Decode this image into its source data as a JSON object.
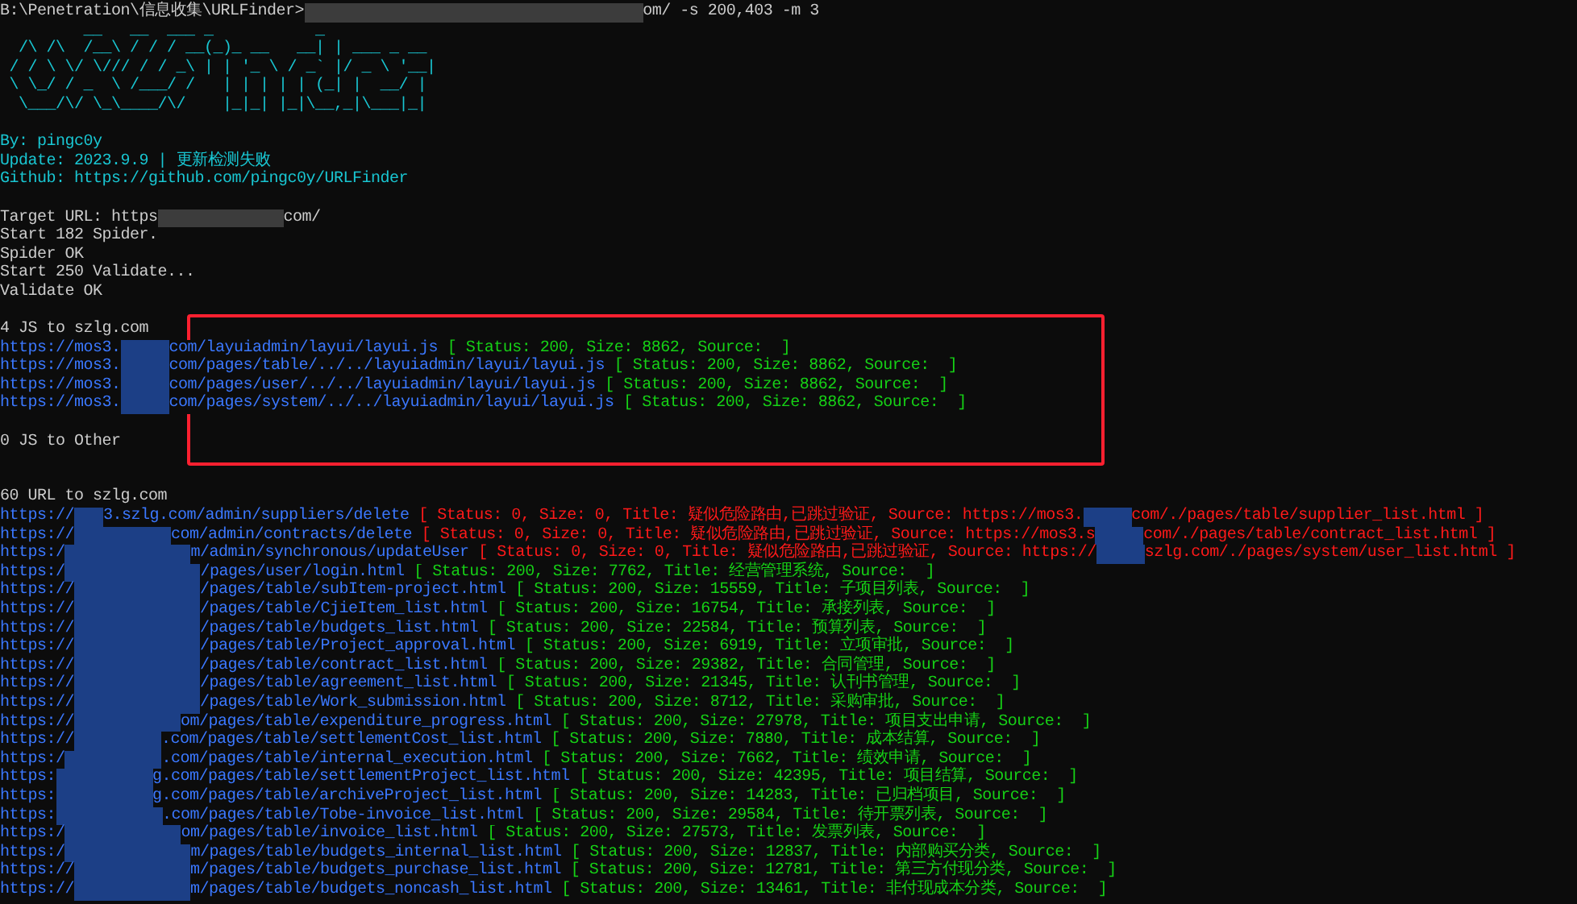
{
  "command": {
    "prompt": "B:\\Penetration\\信息收集\\URLFinder>",
    "tail": "om/ -s 200,403 -m 3"
  },
  "banner": "         __   __  ___ _           _\n  /\\ /\\  /__\\ / / / __(_)_ __   __| | ___ _ __\n / / \\ \\/ \\/// / / _\\ | | '_ \\ / _` |/ _ \\ '__|\n \\ \\_/ / _  \\ /___/ /   | | | | | (_| |  __/ |\n  \\___/\\/ \\_\\____/\\/    |_|_| |_|\\__,_|\\___|_|",
  "info": [
    "By: pingc0y",
    "Update: 2023.9.9 | 更新检测失败",
    "Github: https://github.com/pingc0y/URLFinder"
  ],
  "target": {
    "label": "Target URL: https",
    "tail": "com/"
  },
  "progress": [
    "Start 182 Spider.",
    "Spider OK",
    "Start 250 Validate...",
    "Validate OK"
  ],
  "js_to_target": {
    "heading": "4 JS to szlg.com",
    "results": [
      {
        "kind": "ok",
        "url": [
          "https://mos3.",
          "com/layuiadmin/layui/layui.js"
        ],
        "detail": [
          "[ Status: 200, Size: 8862, Source:  ]"
        ]
      },
      {
        "kind": "ok",
        "url": [
          "https://mos3.",
          "com/pages/table/../../layuiadmin/layui/layui.js"
        ],
        "detail": [
          "[ Status: 200, Size: 8862, Source:  ]"
        ]
      },
      {
        "kind": "ok",
        "url": [
          "https://mos3.",
          "com/pages/user/../../layuiadmin/layui/layui.js"
        ],
        "detail": [
          "[ Status: 200, Size: 8862, Source:  ]"
        ]
      },
      {
        "kind": "ok",
        "url": [
          "https://mos3.",
          "com/pages/system/../../layuiadmin/layui/layui.js"
        ],
        "detail": [
          "[ Status: 200, Size: 8862, Source:  ]"
        ]
      }
    ]
  },
  "js_to_other": {
    "heading": "0 JS to Other"
  },
  "urls": {
    "heading": "60 URL to szlg.com",
    "results": [
      {
        "kind": "danger",
        "url": [
          "https://",
          "3.szlg.com/admin/suppliers/delete"
        ],
        "detail": [
          "[ Status: 0, Size: 0, Title: 疑似危险路由,已跳过验证, Source: https://mos3.",
          "com/./pages/table/supplier_list.html ]"
        ]
      },
      {
        "kind": "danger",
        "url": [
          "https://",
          "com/admin/contracts/delete"
        ],
        "detail": [
          "[ Status: 0, Size: 0, Title: 疑似危险路由,已跳过验证, Source: https://mos3.s",
          "com/./pages/table/contract_list.html ]"
        ]
      },
      {
        "kind": "danger",
        "url": [
          "https:/",
          "m/admin/synchronous/updateUser"
        ],
        "detail": [
          "[ Status: 0, Size: 0, Title: 疑似危险路由,已跳过验证, Source: https://",
          "szlg.com/./pages/system/user_list.html ]"
        ]
      },
      {
        "kind": "ok",
        "url": [
          "https:/",
          "/pages/user/login.html"
        ],
        "detail": [
          "[ Status: 200, Size: 7762, Title: 经营管理系统, Source:  ]"
        ]
      },
      {
        "kind": "ok",
        "url": [
          "https://",
          "/pages/table/subItem-project.html"
        ],
        "detail": [
          "[ Status: 200, Size: 15559, Title: 子项目列表, Source:  ]"
        ]
      },
      {
        "kind": "ok",
        "url": [
          "https://",
          "/pages/table/CjieItem_list.html"
        ],
        "detail": [
          "[ Status: 200, Size: 16754, Title: 承接列表, Source:  ]"
        ]
      },
      {
        "kind": "ok",
        "url": [
          "https://",
          "/pages/table/budgets_list.html"
        ],
        "detail": [
          "[ Status: 200, Size: 22584, Title: 预算列表, Source:  ]"
        ]
      },
      {
        "kind": "ok",
        "url": [
          "https://",
          "/pages/table/Project_approval.html"
        ],
        "detail": [
          "[ Status: 200, Size: 6919, Title: 立项审批, Source:  ]"
        ]
      },
      {
        "kind": "ok",
        "url": [
          "https://",
          "/pages/table/contract_list.html"
        ],
        "detail": [
          "[ Status: 200, Size: 29382, Title: 合同管理, Source:  ]"
        ]
      },
      {
        "kind": "ok",
        "url": [
          "https://",
          "/pages/table/agreement_list.html"
        ],
        "detail": [
          "[ Status: 200, Size: 21345, Title: 认刊书管理, Source:  ]"
        ]
      },
      {
        "kind": "ok",
        "url": [
          "https://",
          "/pages/table/Work_submission.html"
        ],
        "detail": [
          "[ Status: 200, Size: 8712, Title: 采购审批, Source:  ]"
        ]
      },
      {
        "kind": "ok",
        "url": [
          "https://",
          "om/pages/table/expenditure_progress.html"
        ],
        "detail": [
          "[ Status: 200, Size: 27978, Title: 项目支出申请, Source:  ]"
        ]
      },
      {
        "kind": "ok",
        "url": [
          "https://",
          ".com/pages/table/settlementCost_list.html"
        ],
        "detail": [
          "[ Status: 200, Size: 7880, Title: 成本结算, Source:  ]"
        ]
      },
      {
        "kind": "ok",
        "url": [
          "https:/",
          ".com/pages/table/internal_execution.html"
        ],
        "detail": [
          "[ Status: 200, Size: 7662, Title: 绩效申请, Source:  ]"
        ]
      },
      {
        "kind": "ok",
        "url": [
          "https:",
          "g.com/pages/table/settlementProject_list.html"
        ],
        "detail": [
          "[ Status: 200, Size: 42395, Title: 项目结算, Source:  ]"
        ]
      },
      {
        "kind": "ok",
        "url": [
          "https:",
          "g.com/pages/table/archiveProject_list.html"
        ],
        "detail": [
          "[ Status: 200, Size: 14283, Title: 已归档项目, Source:  ]"
        ]
      },
      {
        "kind": "ok",
        "url": [
          "https:",
          ".com/pages/table/Tobe-invoice_list.html"
        ],
        "detail": [
          "[ Status: 200, Size: 29584, Title: 待开票列表, Source:  ]"
        ]
      },
      {
        "kind": "ok",
        "url": [
          "https:/",
          "om/pages/table/invoice_list.html"
        ],
        "detail": [
          "[ Status: 200, Size: 27573, Title: 发票列表, Source:  ]"
        ]
      },
      {
        "kind": "ok",
        "url": [
          "https:/",
          "m/pages/table/budgets_internal_list.html"
        ],
        "detail": [
          "[ Status: 200, Size: 12837, Title: 内部购买分类, Source:  ]"
        ]
      },
      {
        "kind": "ok",
        "url": [
          "https://",
          "m/pages/table/budgets_purchase_list.html"
        ],
        "detail": [
          "[ Status: 200, Size: 12781, Title: 第三方付现分类, Source:  ]"
        ]
      },
      {
        "kind": "ok",
        "url": [
          "https://",
          "m/pages/table/budgets_noncash_list.html"
        ],
        "detail": [
          "[ Status: 200, Size: 13461, Title: 非付现成本分类, Source:  ]"
        ]
      }
    ]
  }
}
